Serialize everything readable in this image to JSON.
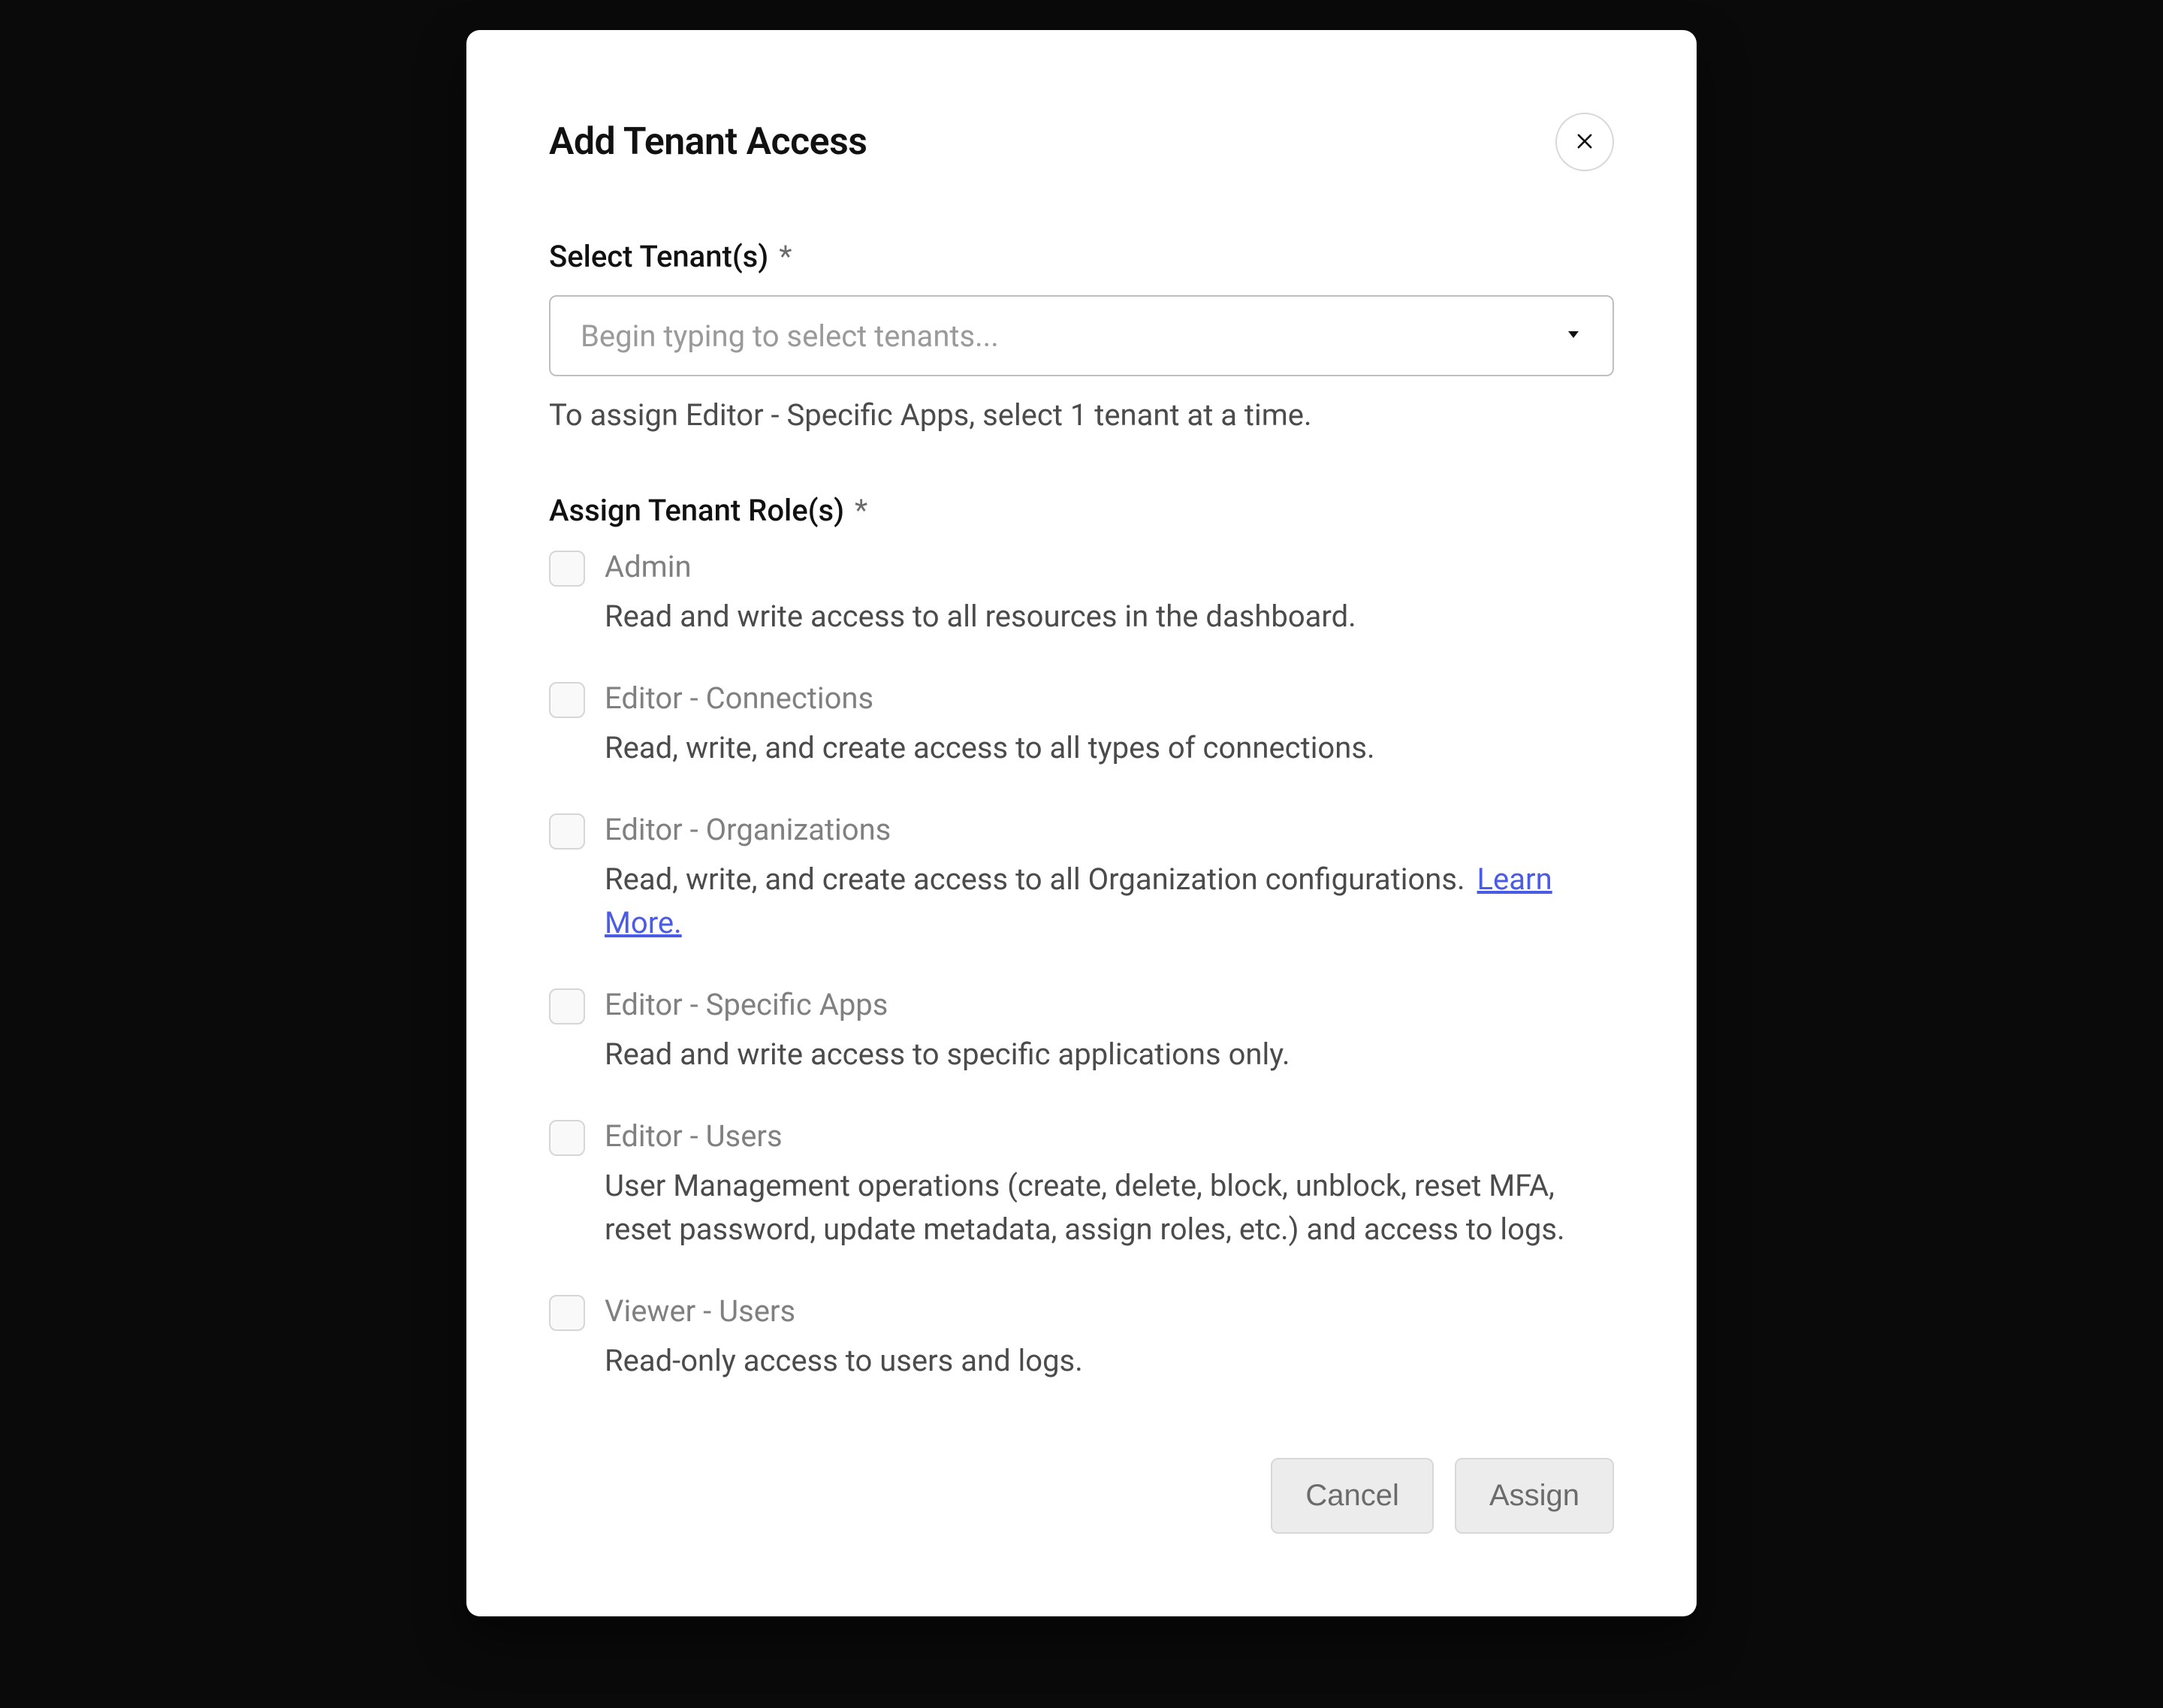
{
  "modal": {
    "title": "Add Tenant Access",
    "close_label": "Close"
  },
  "tenant_select": {
    "label": "Select Tenant(s)",
    "required_mark": "*",
    "placeholder": "Begin typing to select tenants...",
    "helper": "To assign Editor - Specific Apps, select 1 tenant at a time."
  },
  "roles_section": {
    "label": "Assign Tenant Role(s)",
    "required_mark": "*",
    "learn_more_label": "Learn More.",
    "roles": [
      {
        "title": "Admin",
        "desc": "Read and write access to all resources in the dashboard.",
        "has_learn_more": false
      },
      {
        "title": "Editor - Connections",
        "desc": "Read, write, and create access to all types of connections.",
        "has_learn_more": false
      },
      {
        "title": "Editor - Organizations",
        "desc": "Read, write, and create access to all Organization configurations.",
        "has_learn_more": true
      },
      {
        "title": "Editor - Specific Apps",
        "desc": "Read and write access to specific applications only.",
        "has_learn_more": false
      },
      {
        "title": "Editor - Users",
        "desc": "User Management operations (create, delete, block, unblock, reset MFA, reset password, update metadata, assign roles, etc.) and access to logs.",
        "has_learn_more": false
      },
      {
        "title": "Viewer - Users",
        "desc": "Read-only access to users and logs.",
        "has_learn_more": false
      }
    ]
  },
  "footer": {
    "cancel_label": "Cancel",
    "assign_label": "Assign"
  }
}
